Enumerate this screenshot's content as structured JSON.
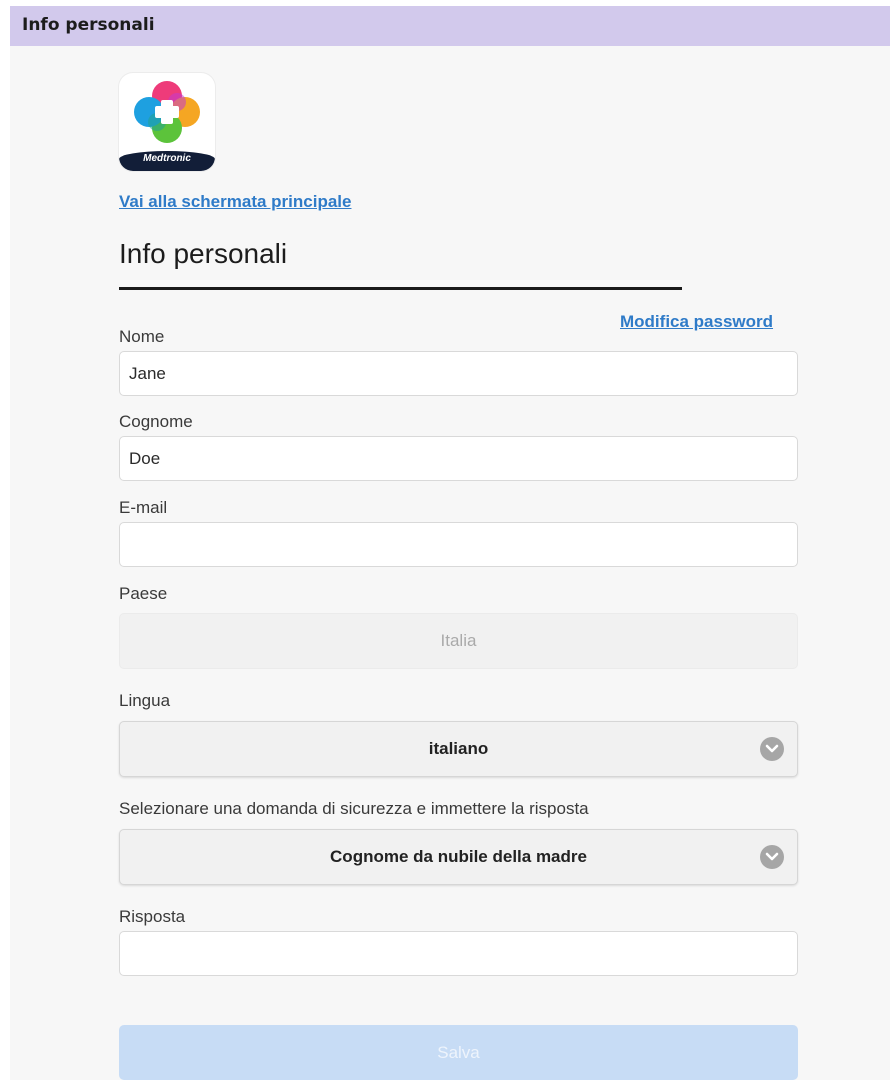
{
  "window": {
    "title": "Info personali"
  },
  "header": {
    "logo": {
      "brand_text": "Medtronic",
      "icon": "medtronic-app-icon"
    },
    "home_link": "Vai alla schermata principale",
    "page_title": "Info personali",
    "change_password_link": "Modifica password"
  },
  "form": {
    "first_name": {
      "label": "Nome",
      "value": "Jane"
    },
    "last_name": {
      "label": "Cognome",
      "value": "Doe"
    },
    "email": {
      "label": "E-mail",
      "value": ""
    },
    "country": {
      "label": "Paese",
      "value": "Italia"
    },
    "language": {
      "label": "Lingua",
      "value": "italiano",
      "icon": "chevron-down-icon"
    },
    "security_question": {
      "label": "Selezionare una domanda di sicurezza e immettere la risposta",
      "value": "Cognome da nubile della madre",
      "icon": "chevron-down-icon"
    },
    "answer": {
      "label": "Risposta",
      "value": ""
    },
    "save_button": "Salva"
  },
  "colors": {
    "title_bar": "#d2c9ec",
    "link": "#2f7bc8",
    "save_button_disabled": "#c7dcf5",
    "panel_background": "#f7f7f7"
  }
}
